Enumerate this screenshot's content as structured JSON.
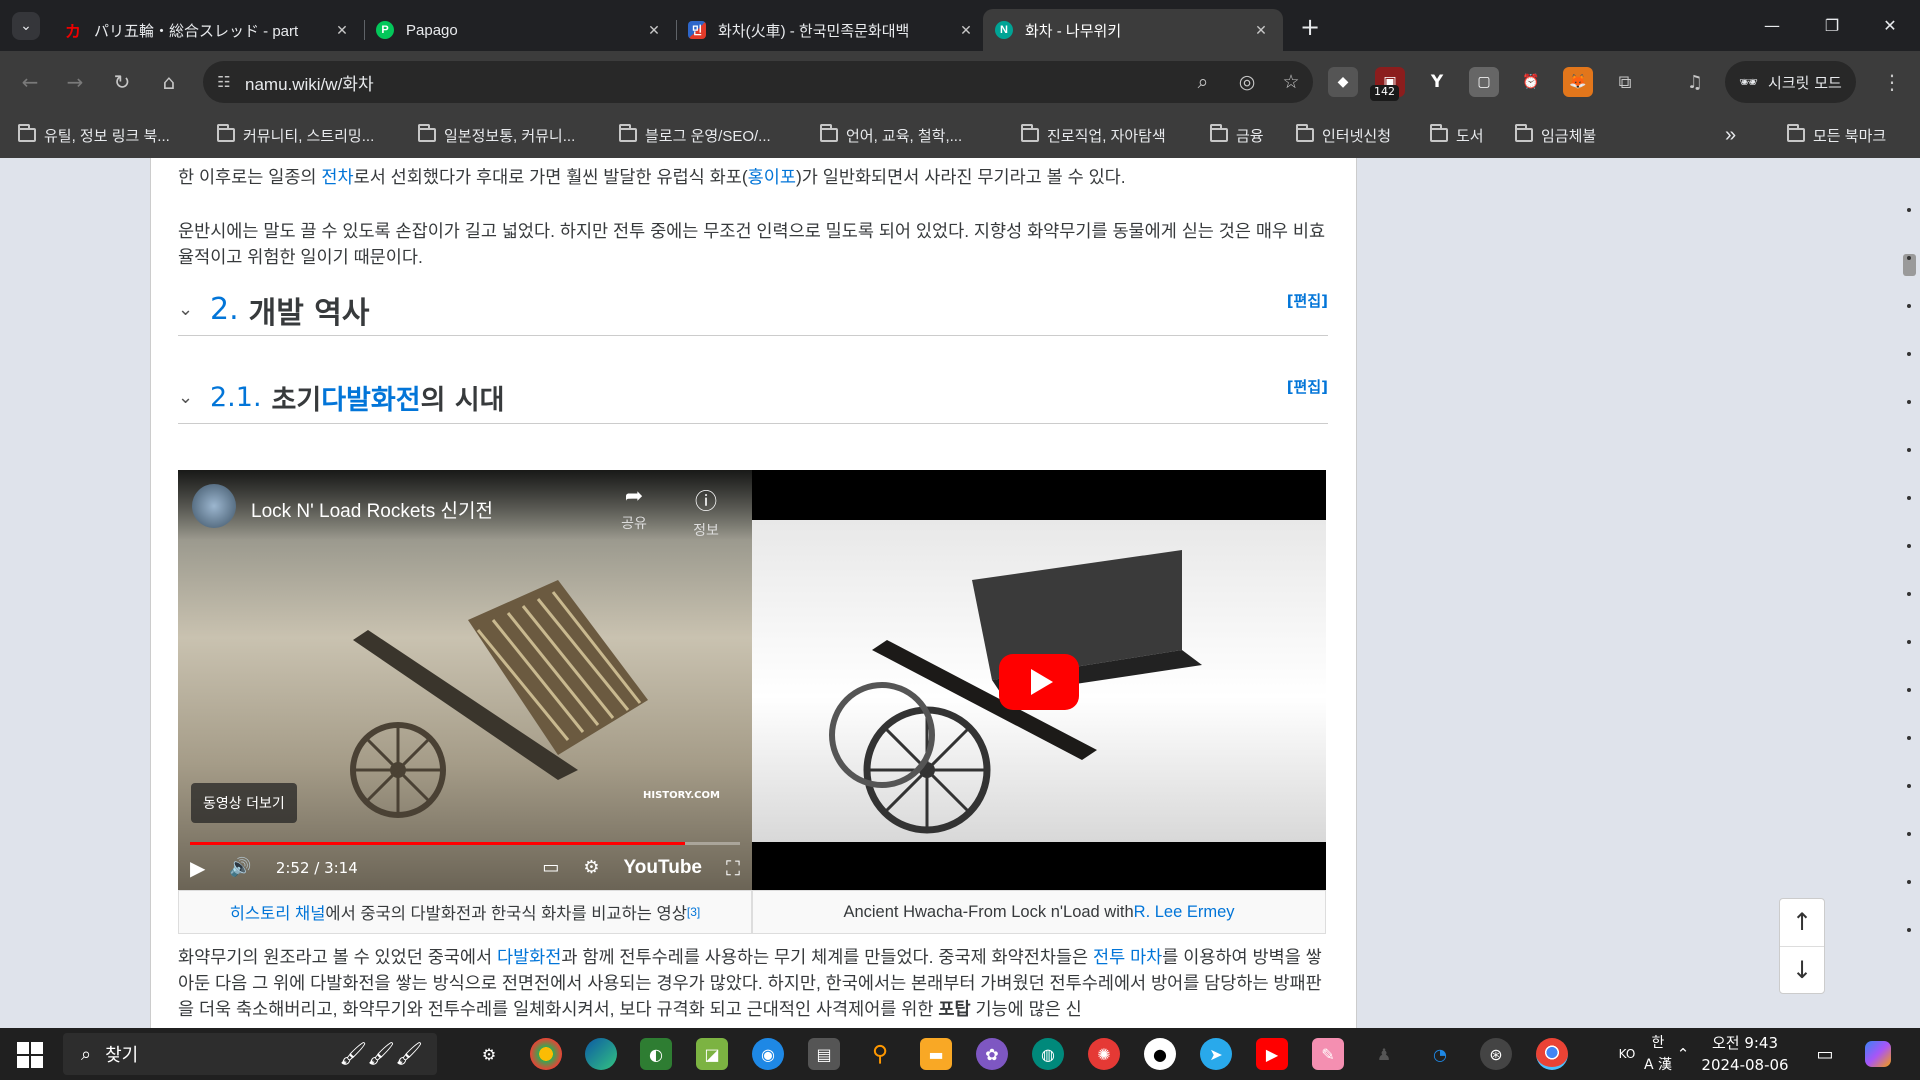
{
  "tabs": [
    {
      "title": "パリ五輪・総合スレッド - part",
      "favicon": "カ",
      "color": "#c00000",
      "active": false
    },
    {
      "title": "Papago",
      "favicon": "P",
      "color": "#03c75a",
      "active": false
    },
    {
      "title": "화차(火車) - 한국민족문화대백",
      "favicon": "민",
      "color": "#e23b2a",
      "active": false
    },
    {
      "title": "화차 - 나무위키",
      "favicon": "N",
      "color": "#00a495",
      "active": true
    }
  ],
  "tab_close_label": "✕",
  "new_tab_label": "+",
  "window": {
    "minimize": "—",
    "restore": "❐",
    "close": "✕"
  },
  "address": {
    "url": "namu.wiki/w/화차"
  },
  "extensions": {
    "badge": "142",
    "ext2": "Y"
  },
  "incognito_label": "시크릿 모드",
  "bookmarks": [
    "유틸, 정보 링크 북...",
    "커뮤니티, 스트리밍...",
    "일본정보통, 커뮤니...",
    "블로그 운영/SEO/...",
    "언어, 교육, 철학,...",
    "진로직업, 자아탐색",
    "금융",
    "인터넷신청",
    "도서",
    "임금체불"
  ],
  "bookmarks_overflow": "»",
  "all_bookmarks": "모든 북마크",
  "article": {
    "para1_line1_pre": "한 이후로는 일종의 ",
    "para1_link": "전차",
    "para1_line1_mid": "로서 선회했다가 후대로 가면 훨씬 발달한 유럽식 화포(",
    "para1_link2": "홍이포",
    "para1_line1_post": ")가 일반화되면서 사라진 무기라고 볼 수 있다.",
    "para2": "운반시에는 말도 끌 수 있도록 손잡이가 길고 넓었다. 하지만 전투 중에는 무조건 인력으로 밀도록 되어 있었다. 지향성 화약무기를 동물에게 싣는 것은 매우 비효율적이고 위험한 일이기 때문이다.",
    "h2_num": "2.",
    "h2_text": "개발 역사",
    "h3_num": "2.1.",
    "h3_pre": "초기 ",
    "h3_link": "다발화전",
    "h3_post": "의 시대",
    "edit_label": "[편집]",
    "para3_a": "화약무기의 원조라고 볼 수 있었던 중국에서 ",
    "para3_link1": "다발화전",
    "para3_b": "과 함께 전투수레를 사용하는 무기 체계를 만들었다. 중국제 화약전차들은 ",
    "para3_link2": "전투 마차",
    "para3_c": "를 이용하여 방벽을 쌓아둔 다음 그 위에 다발화전을 쌓는 방식으로 전면전에서 사용되는 경우가 많았다. 하지만, 한국에서는 본래부터 가벼웠던 전투수레에서 방어를 담당하는 방패판을 더욱 축소해버리고, 화약무기와 전투수레를 일체화시켜서, 보다 규격화 되고 근대적인 사격제어를 위한 ",
    "para3_bold": "포탑",
    "para3_d": " 기능에 많은 신"
  },
  "video1": {
    "title": "Lock N' Load Rockets 신기전",
    "share": "공유",
    "info": "정보",
    "more": "동영상 더보기",
    "time": "2:52 / 3:14",
    "progress": 0.9,
    "brand": "YouTube",
    "watermark": "HISTORY.COM"
  },
  "caption1": {
    "link": "히스토리 채널",
    "text": "에서 중국의 다발화전과 한국식 화차를 비교하는 영상",
    "ref": "[3]"
  },
  "caption2": {
    "text": "Ancient Hwacha-From Lock n'Load with ",
    "link": "R. Lee Ermey"
  },
  "nav_up": "↑",
  "nav_down": "↓",
  "taskbar": {
    "search": "찾기",
    "lang": "KO",
    "ime1": "한",
    "ime2": "A 漢",
    "time": "오전 9:43",
    "date": "2024-08-06"
  }
}
